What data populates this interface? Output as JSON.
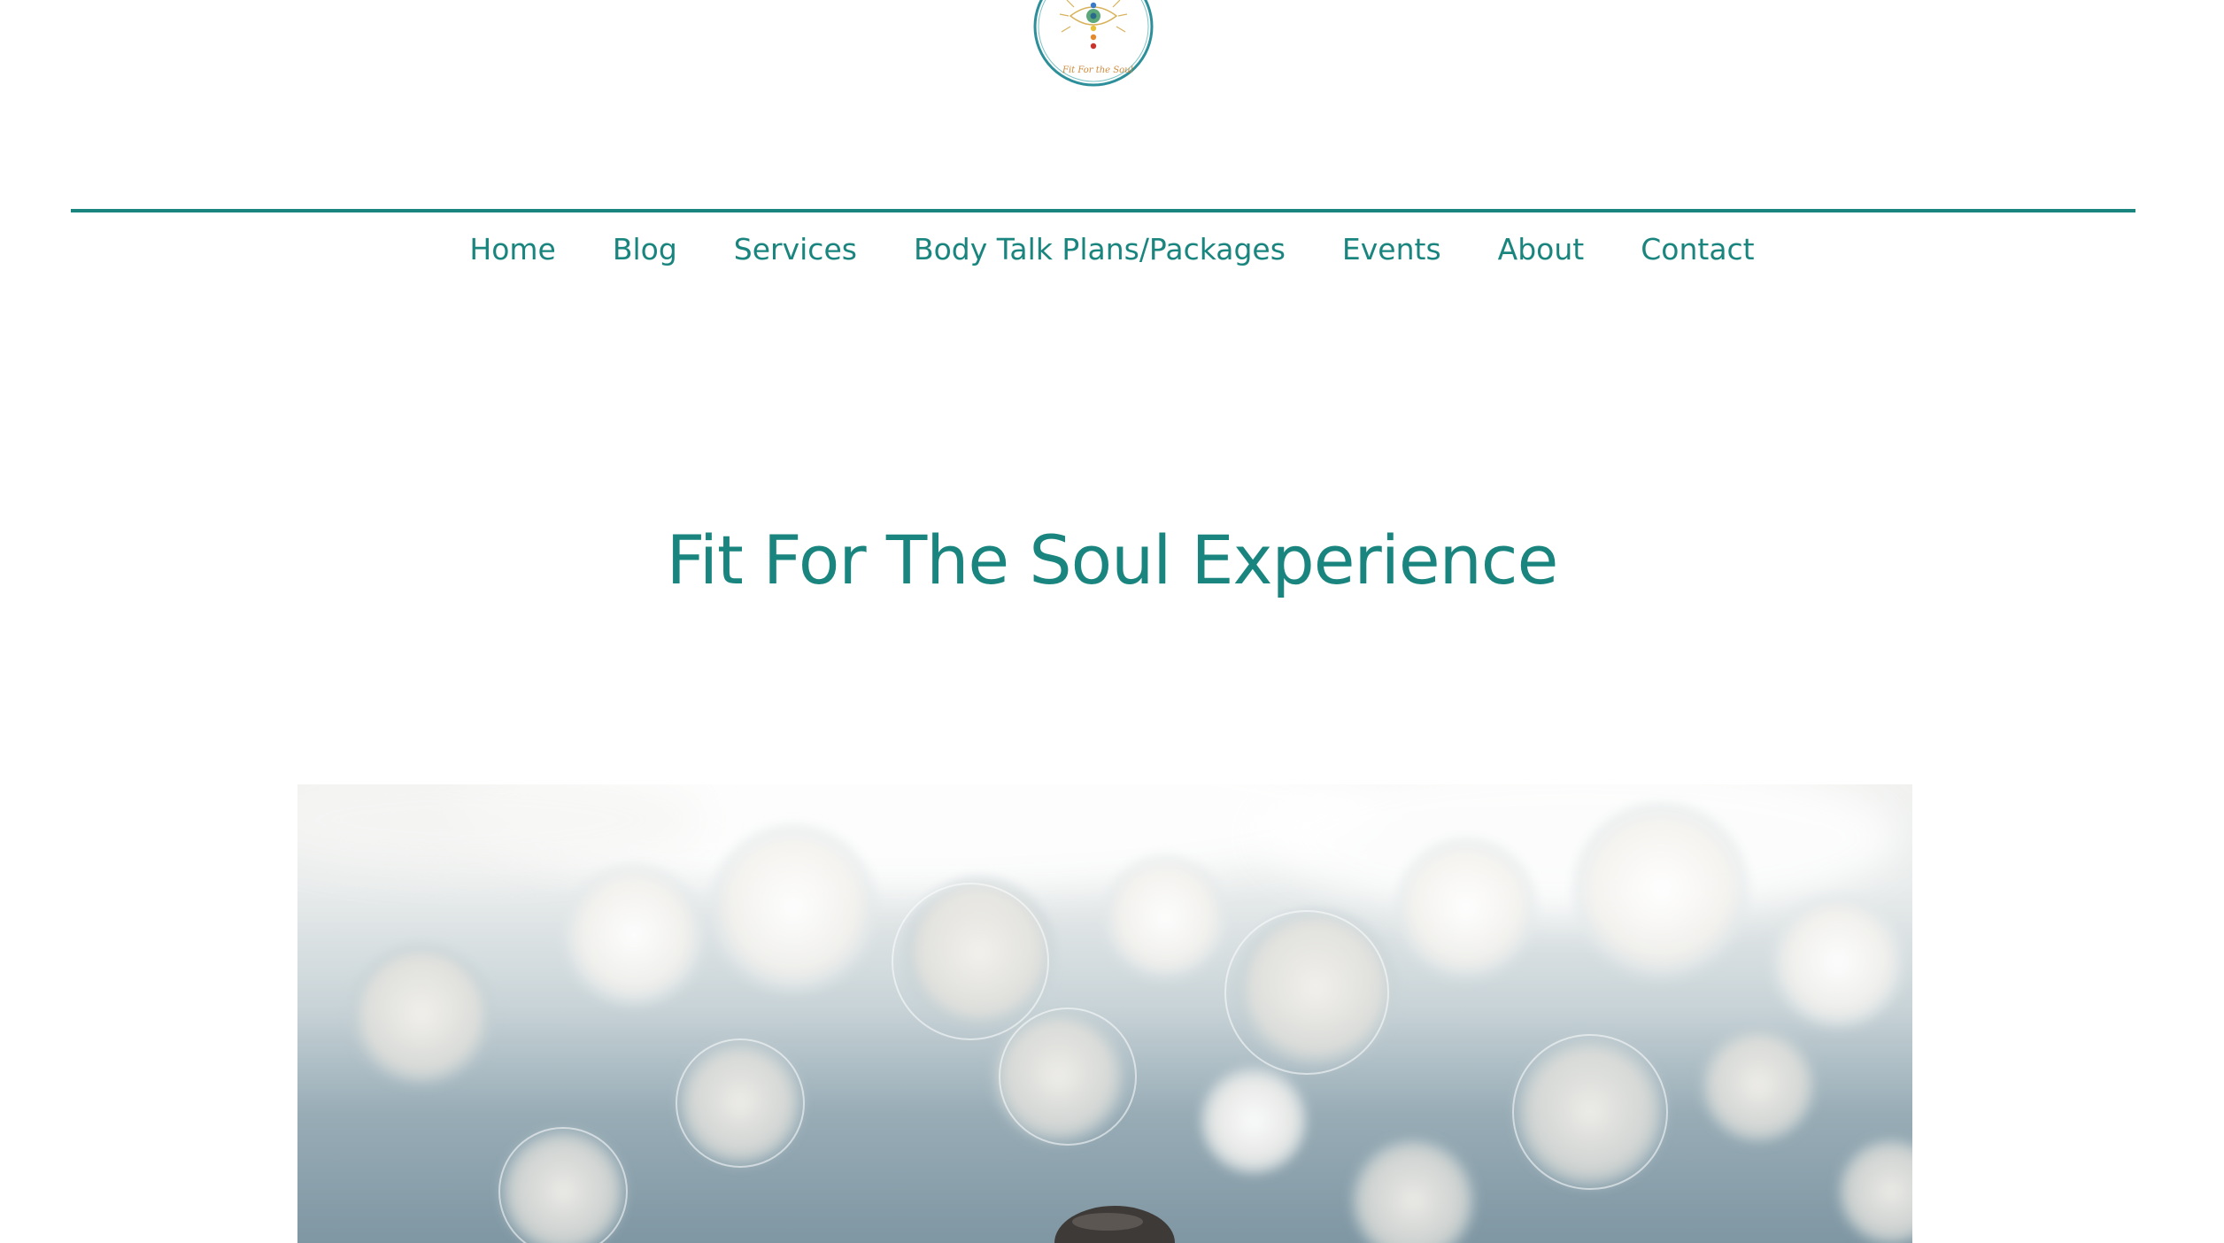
{
  "brand": {
    "logo_caption": "Fit For the Soul",
    "logo_icon": "chakra-eye-logo-icon",
    "accent_color": "#1a857e"
  },
  "nav": {
    "items": [
      {
        "label": "Home"
      },
      {
        "label": "Blog"
      },
      {
        "label": "Services"
      },
      {
        "label": "Body Talk Plans/Packages"
      },
      {
        "label": "Events"
      },
      {
        "label": "About"
      },
      {
        "label": "Contact"
      }
    ]
  },
  "main": {
    "title": "Fit For The Soul Experience",
    "hero_image": "bokeh-water-stone-image"
  }
}
